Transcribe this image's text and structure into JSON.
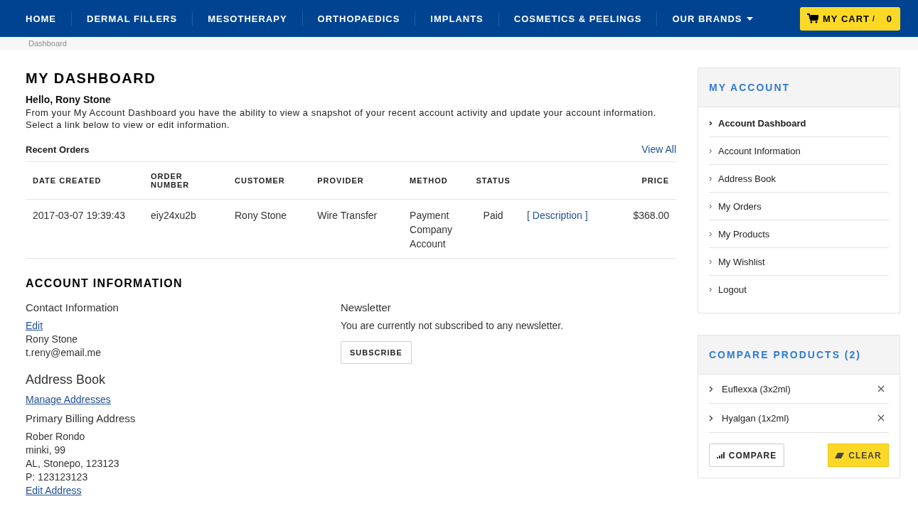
{
  "nav": {
    "items": [
      {
        "label": "HOME",
        "dropdown": false
      },
      {
        "label": "DERMAL FILLERS",
        "dropdown": false
      },
      {
        "label": "MESOTHERAPY",
        "dropdown": false
      },
      {
        "label": "ORTHOPAEDICS",
        "dropdown": false
      },
      {
        "label": "IMPLANTS",
        "dropdown": false
      },
      {
        "label": "COSMETICS & PEELINGS",
        "dropdown": false
      },
      {
        "label": "OUR BRANDS",
        "dropdown": true
      }
    ],
    "cart": {
      "label": "MY CART",
      "separator": "/",
      "count": "0"
    }
  },
  "breadcrumb": "Dashboard",
  "dashboard": {
    "title": "MY DASHBOARD",
    "greeting": "Hello, Rony Stone",
    "intro": "From your My Account Dashboard you have the ability to view a snapshot of your recent account activity and update your account information. Select a link below to view or edit information.",
    "recent_orders": {
      "title": "Recent Orders",
      "view_all": "View All",
      "columns": [
        "DATE CREATED",
        "ORDER NUMBER",
        "CUSTOMER",
        "PROVIDER",
        "METHOD",
        "STATUS",
        "PRICE"
      ],
      "rows": [
        {
          "date": "2017-03-07 19:39:43",
          "order": "eiy24xu2b",
          "customer": "Rony Stone",
          "provider": "Wire Transfer",
          "method": "Payment Company Account",
          "status": "Paid",
          "link": "[ Description ]",
          "price": "$368.00"
        }
      ]
    }
  },
  "account_information": {
    "title": "ACCOUNT INFORMATION",
    "contact": {
      "title": "Contact Information",
      "edit": "Edit",
      "name": "Rony Stone",
      "email": "t.reny@email.me"
    },
    "newsletter": {
      "title": "Newsletter",
      "text": "You are currently not subscribed to any newsletter.",
      "button": "SUBSCRIBE"
    },
    "address_book": {
      "title": "Address Book",
      "manage": "Manage Addresses",
      "billing_title": "Primary Billing Address",
      "lines": [
        "Rober Rondo",
        "minki, 99",
        "AL, Stonepo, 123123",
        "P: 123123123"
      ],
      "edit": "Edit Address"
    }
  },
  "sidebar": {
    "title": "MY ACCOUNT",
    "items": [
      {
        "label": "Account Dashboard",
        "selected": true
      },
      {
        "label": "Account Information",
        "selected": false
      },
      {
        "label": "Address Book",
        "selected": false
      },
      {
        "label": "My Orders",
        "selected": false
      },
      {
        "label": "My Products",
        "selected": false
      },
      {
        "label": "My Wishlist",
        "selected": false
      },
      {
        "label": "Logout",
        "selected": false
      }
    ]
  },
  "compare": {
    "title": "COMPARE PRODUCTS (2)",
    "items": [
      "Euflexxa (3x2ml)",
      "Hyalgan (1x2ml)"
    ],
    "compare_button": "COMPARE",
    "clear_button": "CLEAR"
  }
}
